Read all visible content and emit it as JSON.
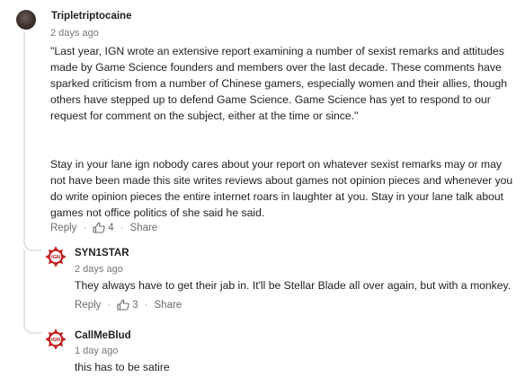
{
  "comments": [
    {
      "username": "Tripletriptocaine",
      "timestamp": "2 days ago",
      "avatar": "user-photo",
      "paragraphs": [
        "\"Last year, IGN wrote an extensive report examining a number of sexist remarks and attitudes made by Game Science founders and members over the last decade. These comments have sparked criticism from a number of Chinese gamers, especially women and their allies, though others have stepped up to defend Game Science. Game Science has yet to respond to our request for comment on the subject, either at the time or since.\"",
        "Stay in your lane ign nobody cares about your report on whatever sexist remarks may or may not have been made this site writes reviews about games not opinion pieces and whenever you do write opinion pieces the entire internet roars in laughter at you. Stay in your lane talk about games not office politics of she said he said."
      ],
      "actions": {
        "reply": "Reply",
        "likes": "4",
        "share": "Share"
      }
    },
    {
      "username": "SYN1STAR",
      "timestamp": "2 days ago",
      "avatar": "ign-logo",
      "paragraphs": [
        "They always have to get their jab in. It'll be Stellar Blade all over again, but with a monkey."
      ],
      "actions": {
        "reply": "Reply",
        "likes": "3",
        "share": "Share"
      }
    },
    {
      "username": "CallMeBlud",
      "timestamp": "1 day ago",
      "avatar": "ign-logo",
      "paragraphs": [
        "this has to be satire"
      ]
    }
  ],
  "colors": {
    "ign_red": "#bf1313",
    "text": "#1f1f1f",
    "muted": "#777777",
    "thread": "#e3e3e3"
  }
}
